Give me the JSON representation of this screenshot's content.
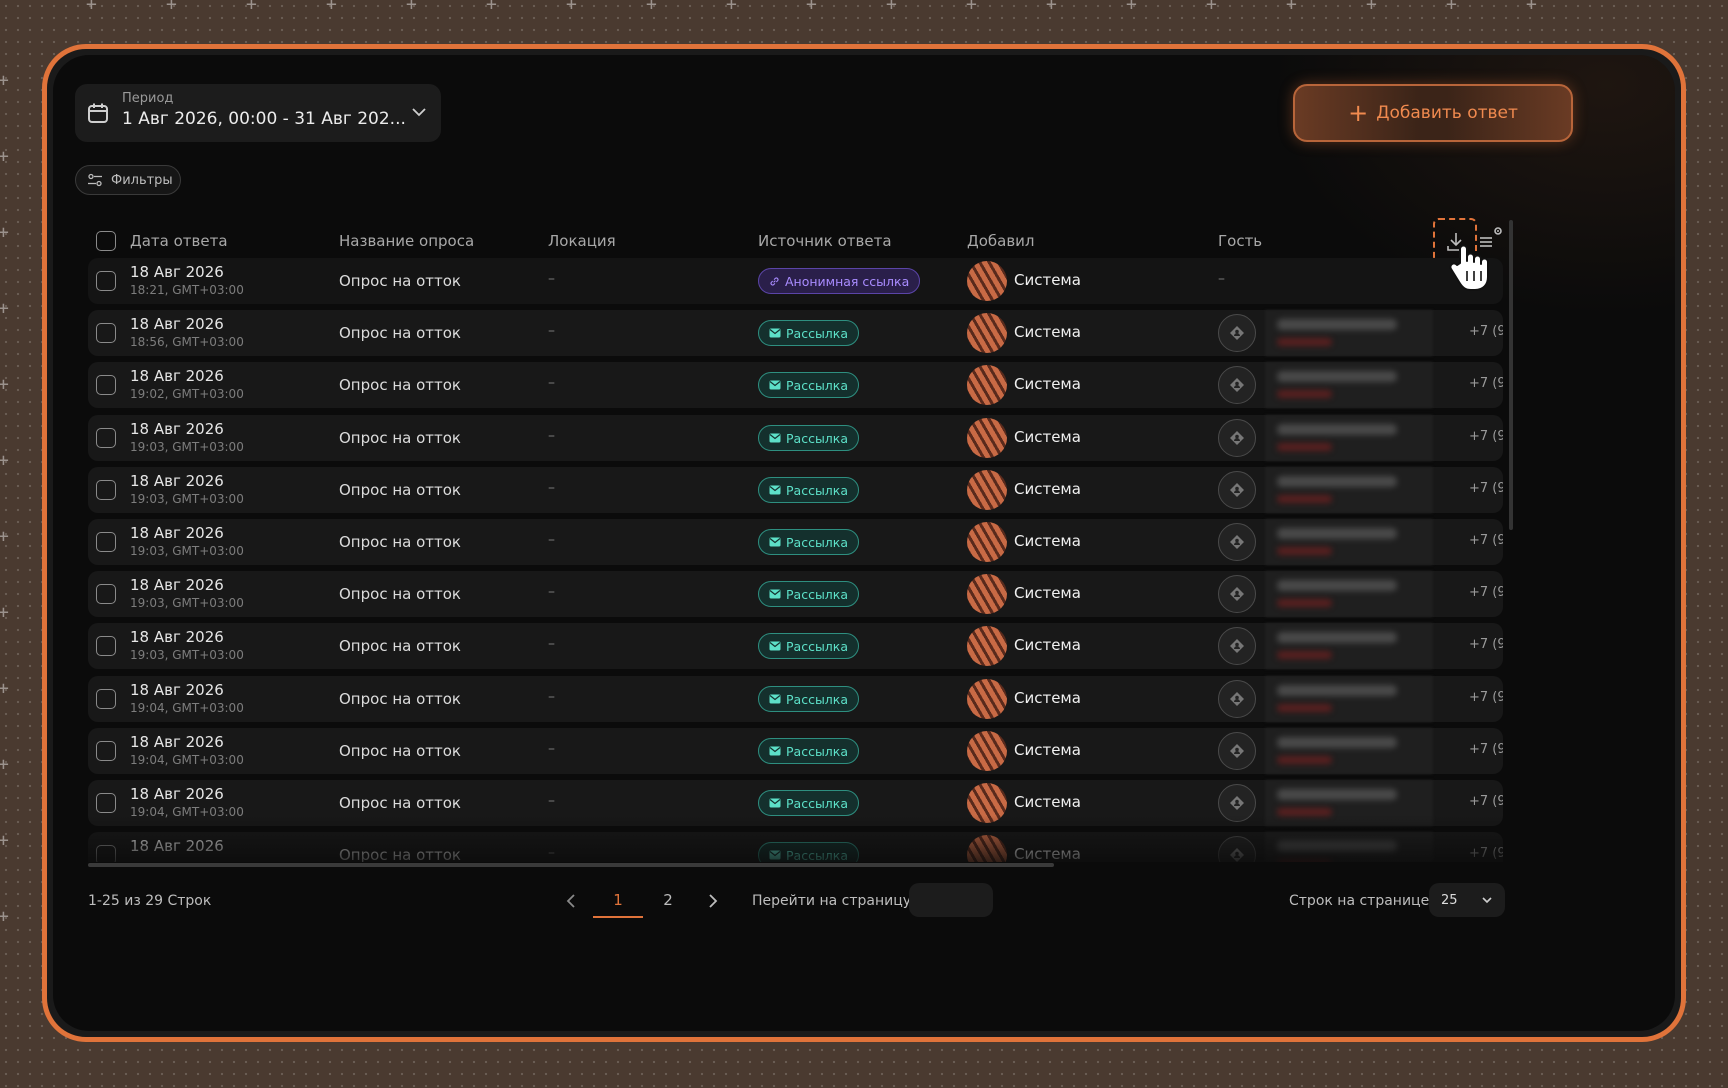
{
  "period": {
    "label": "Период",
    "value": "1 Авг 2026, 00:00 - 31 Авг 202..."
  },
  "add_button": {
    "label": "Добавить ответ"
  },
  "filters": {
    "label": "Фильтры"
  },
  "table": {
    "columns": [
      "Дата ответа",
      "Название опроса",
      "Локация",
      "Источник ответа",
      "Добавил",
      "Гость"
    ],
    "rows": [
      {
        "date": "18 Авг 2026",
        "time": "18:21, GMT+03:00",
        "survey": "Опрос на отток",
        "location": "–",
        "source": "Анонимная ссылка",
        "source_type": "anon",
        "added_by": "Система",
        "guest": "–",
        "phone": ""
      },
      {
        "date": "18 Авг 2026",
        "time": "18:56, GMT+03:00",
        "survey": "Опрос на отток",
        "location": "–",
        "source": "Рассылка",
        "source_type": "mail",
        "added_by": "Система",
        "guest": "",
        "phone": "+7 (9"
      },
      {
        "date": "18 Авг 2026",
        "time": "19:02, GMT+03:00",
        "survey": "Опрос на отток",
        "location": "–",
        "source": "Рассылка",
        "source_type": "mail",
        "added_by": "Система",
        "guest": "",
        "phone": "+7 (9"
      },
      {
        "date": "18 Авг 2026",
        "time": "19:03, GMT+03:00",
        "survey": "Опрос на отток",
        "location": "–",
        "source": "Рассылка",
        "source_type": "mail",
        "added_by": "Система",
        "guest": "",
        "phone": "+7 (9"
      },
      {
        "date": "18 Авг 2026",
        "time": "19:03, GMT+03:00",
        "survey": "Опрос на отток",
        "location": "–",
        "source": "Рассылка",
        "source_type": "mail",
        "added_by": "Система",
        "guest": "",
        "phone": "+7 (9"
      },
      {
        "date": "18 Авг 2026",
        "time": "19:03, GMT+03:00",
        "survey": "Опрос на отток",
        "location": "–",
        "source": "Рассылка",
        "source_type": "mail",
        "added_by": "Система",
        "guest": "",
        "phone": "+7 (9"
      },
      {
        "date": "18 Авг 2026",
        "time": "19:03, GMT+03:00",
        "survey": "Опрос на отток",
        "location": "–",
        "source": "Рассылка",
        "source_type": "mail",
        "added_by": "Система",
        "guest": "",
        "phone": "+7 (9"
      },
      {
        "date": "18 Авг 2026",
        "time": "19:03, GMT+03:00",
        "survey": "Опрос на отток",
        "location": "–",
        "source": "Рассылка",
        "source_type": "mail",
        "added_by": "Система",
        "guest": "",
        "phone": "+7 (9"
      },
      {
        "date": "18 Авг 2026",
        "time": "19:04, GMT+03:00",
        "survey": "Опрос на отток",
        "location": "–",
        "source": "Рассылка",
        "source_type": "mail",
        "added_by": "Система",
        "guest": "",
        "phone": "+7 (9"
      },
      {
        "date": "18 Авг 2026",
        "time": "19:04, GMT+03:00",
        "survey": "Опрос на отток",
        "location": "–",
        "source": "Рассылка",
        "source_type": "mail",
        "added_by": "Система",
        "guest": "",
        "phone": "+7 (9"
      },
      {
        "date": "18 Авг 2026",
        "time": "19:04, GMT+03:00",
        "survey": "Опрос на отток",
        "location": "–",
        "source": "Рассылка",
        "source_type": "mail",
        "added_by": "Система",
        "guest": "",
        "phone": "+7 (9"
      },
      {
        "date": "18 Авг 2026",
        "time": "",
        "survey": "Опрос на отток",
        "location": "–",
        "source": "Рассылка",
        "source_type": "mail",
        "added_by": "Система",
        "guest": "",
        "phone": "+7 (9"
      }
    ]
  },
  "pagination": {
    "range": "1-25 из 29 Строк",
    "pages": [
      "1",
      "2"
    ],
    "current": "1",
    "goto_label": "Перейти на страницу",
    "goto_value": "",
    "rows_label": "Строк на странице",
    "rows_value": "25"
  },
  "colors": {
    "accent": "#e0733a",
    "mail_badge": "#5de0c8",
    "anon_badge": "#a98cff",
    "background": "#0b0b0b"
  },
  "icons": [
    "calendar-icon",
    "chevron-down-icon",
    "plus-icon",
    "filter-icon",
    "download-icon",
    "column-settings-icon",
    "hand-cursor-icon",
    "link-icon",
    "mail-icon",
    "guest-icon",
    "chevron-left-icon",
    "chevron-right-icon"
  ]
}
